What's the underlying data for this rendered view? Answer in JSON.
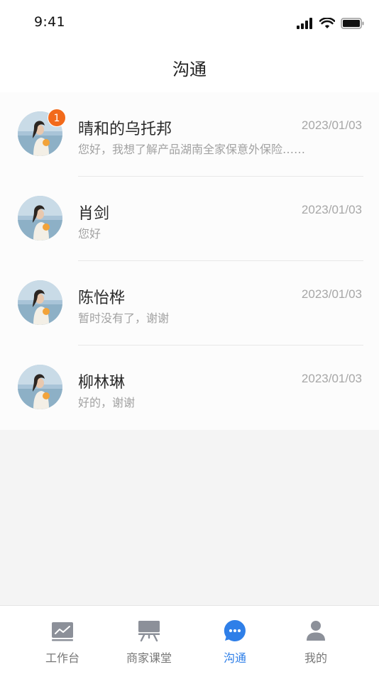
{
  "status_bar": {
    "time": "9:41"
  },
  "header": {
    "title": "沟通"
  },
  "conversations": [
    {
      "name": "晴和的乌托邦",
      "date": "2023/01/03",
      "message": "您好，我想了解产品湖南全家保意外保险……",
      "unread": "1"
    },
    {
      "name": "肖剑",
      "date": "2023/01/03",
      "message": "您好"
    },
    {
      "name": "陈怡桦",
      "date": "2023/01/03",
      "message": "暂时没有了，谢谢"
    },
    {
      "name": "柳林琳",
      "date": "2023/01/03",
      "message": "好的，谢谢"
    }
  ],
  "tabs": [
    {
      "label": "工作台",
      "icon": "chart-icon"
    },
    {
      "label": "商家课堂",
      "icon": "presentation-board-icon"
    },
    {
      "label": "沟通",
      "icon": "chat-bubble-icon",
      "active": true
    },
    {
      "label": "我的",
      "icon": "person-icon"
    }
  ],
  "colors": {
    "accent": "#2f7fe8",
    "badge": "#f26a1b",
    "inactive_icon": "#8c9099"
  }
}
